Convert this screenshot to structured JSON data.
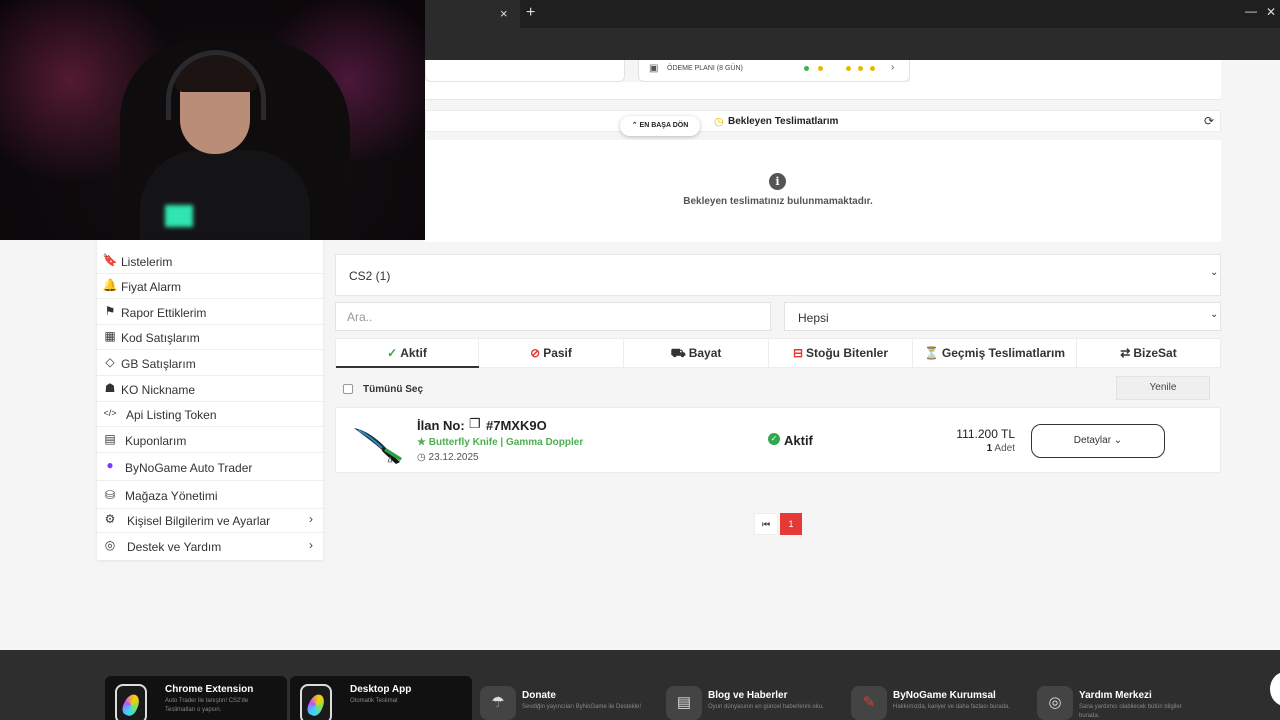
{
  "browser": {
    "tab_close": "×",
    "new_tab": "+",
    "minimize": "—",
    "close": "✕",
    "icons": [
      "star-icon",
      "extensions-icon",
      "media-icon"
    ]
  },
  "payment": {
    "label": "ÖDEME PLANI (8 GÜN)",
    "dot_colors": [
      "#3cb44b",
      "#e6b800",
      "#e6b800",
      "#e6b800",
      "#e6b800"
    ],
    "chevron": "›"
  },
  "pending": {
    "back_to_top": "⌃ EN BAŞA DÖN",
    "title": "Bekleyen Teslimatlarım",
    "empty_message": "Bekleyen teslimatınız bulunmamaktadır.",
    "info_icon": "i",
    "refresh_icon": "⟳"
  },
  "sidebar": {
    "items": [
      {
        "icon": "🔖",
        "icon_name": "bookmark-icon",
        "label": "Listelerim"
      },
      {
        "icon": "🔔",
        "icon_name": "bell-icon",
        "label": "Fiyat Alarm"
      },
      {
        "icon": "⚑",
        "icon_name": "flag-icon",
        "label": "Rapor Ettiklerim"
      },
      {
        "icon": "▦",
        "icon_name": "code-card-icon",
        "label": "Kod Satışlarım"
      },
      {
        "icon": "◇",
        "icon_name": "diamond-icon",
        "label": "GB Satışlarım"
      },
      {
        "icon": "☗",
        "icon_name": "user-badge-icon",
        "label": "KO Nickname"
      },
      {
        "icon": "</>",
        "icon_name": "code-icon",
        "label": "Api Listing Token"
      },
      {
        "icon": "▤",
        "icon_name": "coupon-icon",
        "label": "Kuponlarım"
      },
      {
        "icon": "●",
        "icon_name": "bynogame-logo-icon",
        "label": "ByNoGame Auto Trader"
      },
      {
        "icon": "⛁",
        "icon_name": "store-icon",
        "label": "Mağaza Yönetimi"
      },
      {
        "icon": "⚙",
        "icon_name": "user-settings-icon",
        "label": "Kişisel Bilgilerim ve Ayarlar",
        "chevron": "›"
      },
      {
        "icon": "◎",
        "icon_name": "help-icon",
        "label": "Destek ve Yardım",
        "chevron": "›"
      }
    ]
  },
  "filters": {
    "game": "CS2 (1)",
    "search_placeholder": "Ara..",
    "status_filter": "Hepsi",
    "chevron": "⌄"
  },
  "tabs": [
    {
      "icon": "✓",
      "icon_name": "check-circle-icon",
      "label": "Aktif",
      "color": "#2fa84f"
    },
    {
      "icon": "⊘",
      "icon_name": "ban-icon",
      "label": "Pasif",
      "color": "#e53935"
    },
    {
      "icon": "⛟",
      "icon_name": "truck-icon",
      "label": "Bayat",
      "color": "#333333"
    },
    {
      "icon": "⊟",
      "icon_name": "box-minus-icon",
      "label": "Stoğu Bitenler",
      "color": "#e53935"
    },
    {
      "icon": "⏳",
      "icon_name": "hourglass-icon",
      "label": "Geçmiş Teslimatlarım",
      "color": "#e6b800"
    },
    {
      "icon": "⇄",
      "icon_name": "handshake-icon",
      "label": "BizeSat",
      "color": "#333333"
    }
  ],
  "list": {
    "select_all": "Tümünü Seç",
    "refresh": "Yenile"
  },
  "listing": {
    "number_label": "İlan No:",
    "number": "#7MXK9O",
    "item_name": "★ Butterfly Knife | Gamma Doppler",
    "date": "23.12.2025",
    "status": "Aktif",
    "price": "111.200 TL",
    "qty_num": "1",
    "qty_unit": "Adet",
    "details": "Detaylar ⌄"
  },
  "pagination": {
    "first": "⏮",
    "current": "1"
  },
  "footer": {
    "apps": [
      {
        "title": "Chrome Extension",
        "sub": "Auto Trader ile tanıştın! CS2'de Teslimatları o yapsın."
      },
      {
        "title": "Desktop App",
        "sub": "Otomatik Teslimat"
      }
    ],
    "items": [
      {
        "icon": "☂",
        "icon_name": "donate-icon",
        "title": "Donate",
        "sub": "Sevdiğin yayıncıları ByNoGame ile Destekle!"
      },
      {
        "icon": "▤",
        "icon_name": "news-icon",
        "title": "Blog ve Haberler",
        "sub": "Oyun dünyasının en güncel haberlerini oku."
      },
      {
        "icon": "✎",
        "icon_name": "feather-icon",
        "title": "ByNoGame Kurumsal",
        "sub": "Hakkımızda, kariyer ve daha fazlası burada."
      },
      {
        "icon": "◎",
        "icon_name": "lifebuoy-icon",
        "title": "Yardım Merkezi",
        "sub": "Sana yardımcı olabilecek bütün bilgiler burada."
      }
    ]
  }
}
